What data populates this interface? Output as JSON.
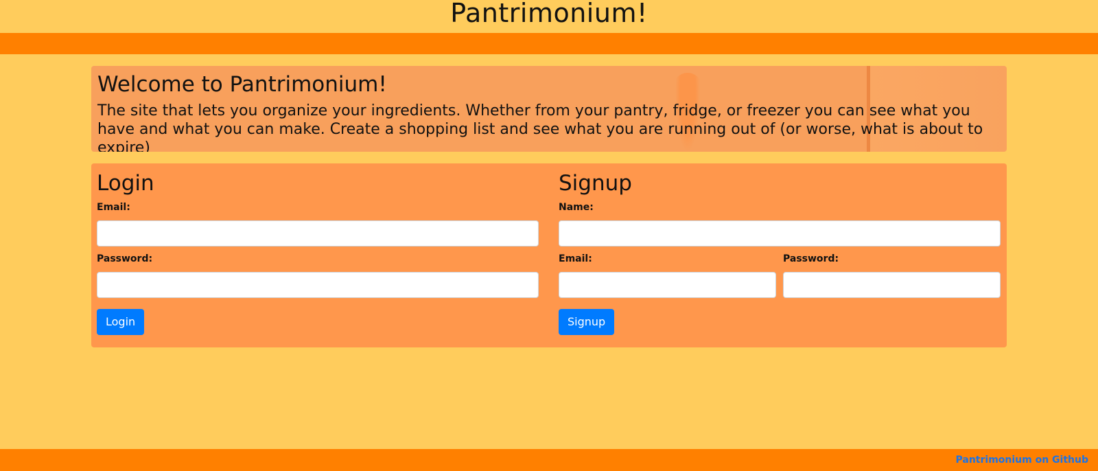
{
  "header": {
    "title": "Pantrimonium!"
  },
  "welcome": {
    "heading": "Welcome to Pantrimonium!",
    "body": "The site that lets you organize your ingredients. Whether from your pantry, fridge, or freezer you can see what you have and what you can make. Create a shopping list and see what you are running out of (or worse, what is about to expire)"
  },
  "login": {
    "heading": "Login",
    "email_label": "Email:",
    "email_value": "",
    "password_label": "Password:",
    "password_value": "",
    "button": "Login"
  },
  "signup": {
    "heading": "Signup",
    "name_label": "Name:",
    "name_value": "",
    "email_label": "Email:",
    "email_value": "",
    "password_label": "Password:",
    "password_value": "",
    "button": "Signup"
  },
  "footer": {
    "link": "Pantrimonium on Github"
  },
  "colors": {
    "page_bg": "#ffcc5c",
    "bar": "#ff8000",
    "panel": "#ff974c",
    "button": "#007bff"
  }
}
